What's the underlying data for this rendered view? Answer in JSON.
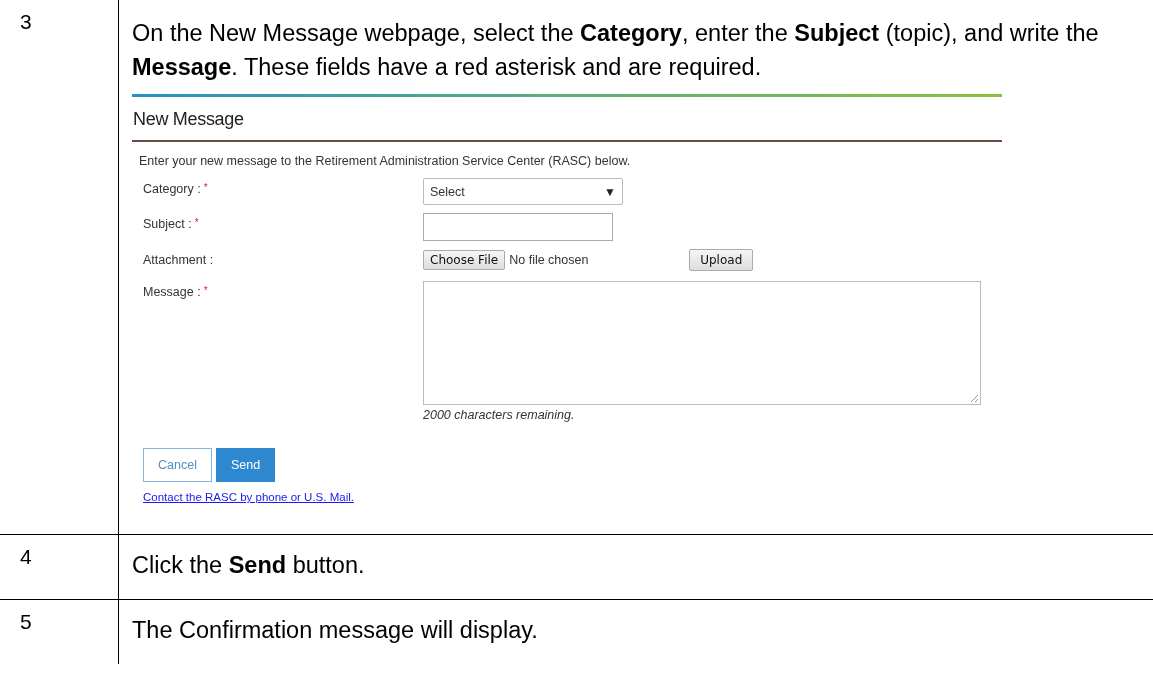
{
  "steps": [
    {
      "number": "3",
      "text": "On the New Message webpage, select the **Category**, enter the **Subject** (topic), and write the **Message**. These fields have a red asterisk and are required.",
      "form": {
        "title": "New Message",
        "intro": "Enter your new message to the Retirement Administration Service Center (RASC) below.",
        "required_mark": "*",
        "fields": [
          {
            "kind": "select",
            "label": "Category :",
            "required": true,
            "value": "Select",
            "caret": "▼"
          },
          {
            "kind": "text",
            "label": "Subject :",
            "required": true
          },
          {
            "kind": "file",
            "label": "Attachment :",
            "required": false,
            "button": "Choose File",
            "status": "No file chosen",
            "upload": "Upload"
          },
          {
            "kind": "textarea",
            "label": "Message :",
            "required": true,
            "hint": "2000 characters remaining."
          }
        ],
        "buttons": [
          {
            "label": "Cancel",
            "kind": "secondary"
          },
          {
            "label": "Send",
            "kind": "primary"
          }
        ],
        "link": "Contact the RASC by phone or U.S. Mail."
      }
    },
    {
      "number": "4",
      "text": "Click the **Send** button."
    },
    {
      "number": "5",
      "text": "The Confirmation message will display."
    }
  ]
}
